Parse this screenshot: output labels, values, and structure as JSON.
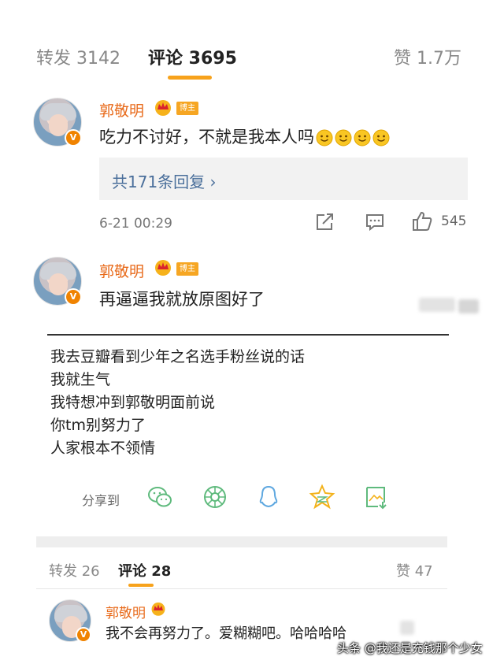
{
  "top_tabs": {
    "repost": "转发 3142",
    "comment": "评论 3695",
    "like": "赞 1.7万"
  },
  "comment1": {
    "author": "郭敬明",
    "badge": "博主",
    "text": "吃力不讨好，不就是我本人吗",
    "emoji_count": 4,
    "replies_label": "共171条回复",
    "time": "6-21 00:29",
    "like_count": "545"
  },
  "comment2": {
    "author": "郭敬明",
    "badge": "博主",
    "text": "再逼逼我就放原图好了"
  },
  "post_lines": [
    "我去豆瓣看到少年之名选手粉丝说的话",
    "我就生气",
    "我特想冲到郭敬明面前说",
    "你tm别努力了",
    "人家根本不领情"
  ],
  "share": {
    "label": "分享到",
    "targets": [
      "wechat-icon",
      "moments-icon",
      "qq-icon",
      "qzone-icon",
      "save-image-icon"
    ]
  },
  "bottom_tabs": {
    "repost": "转发 26",
    "comment": "评论 28",
    "like": "赞 47"
  },
  "comment3": {
    "author": "郭敬明",
    "text": "我不会再努力了。爱糊糊吧。哈哈哈哈"
  },
  "watermark": "头条 @我还是充钱那个少女",
  "colors": {
    "accent": "#f7a21b",
    "name": "#e86a1a",
    "link": "#4a6f9b",
    "share_icon": "#5fba7d"
  }
}
